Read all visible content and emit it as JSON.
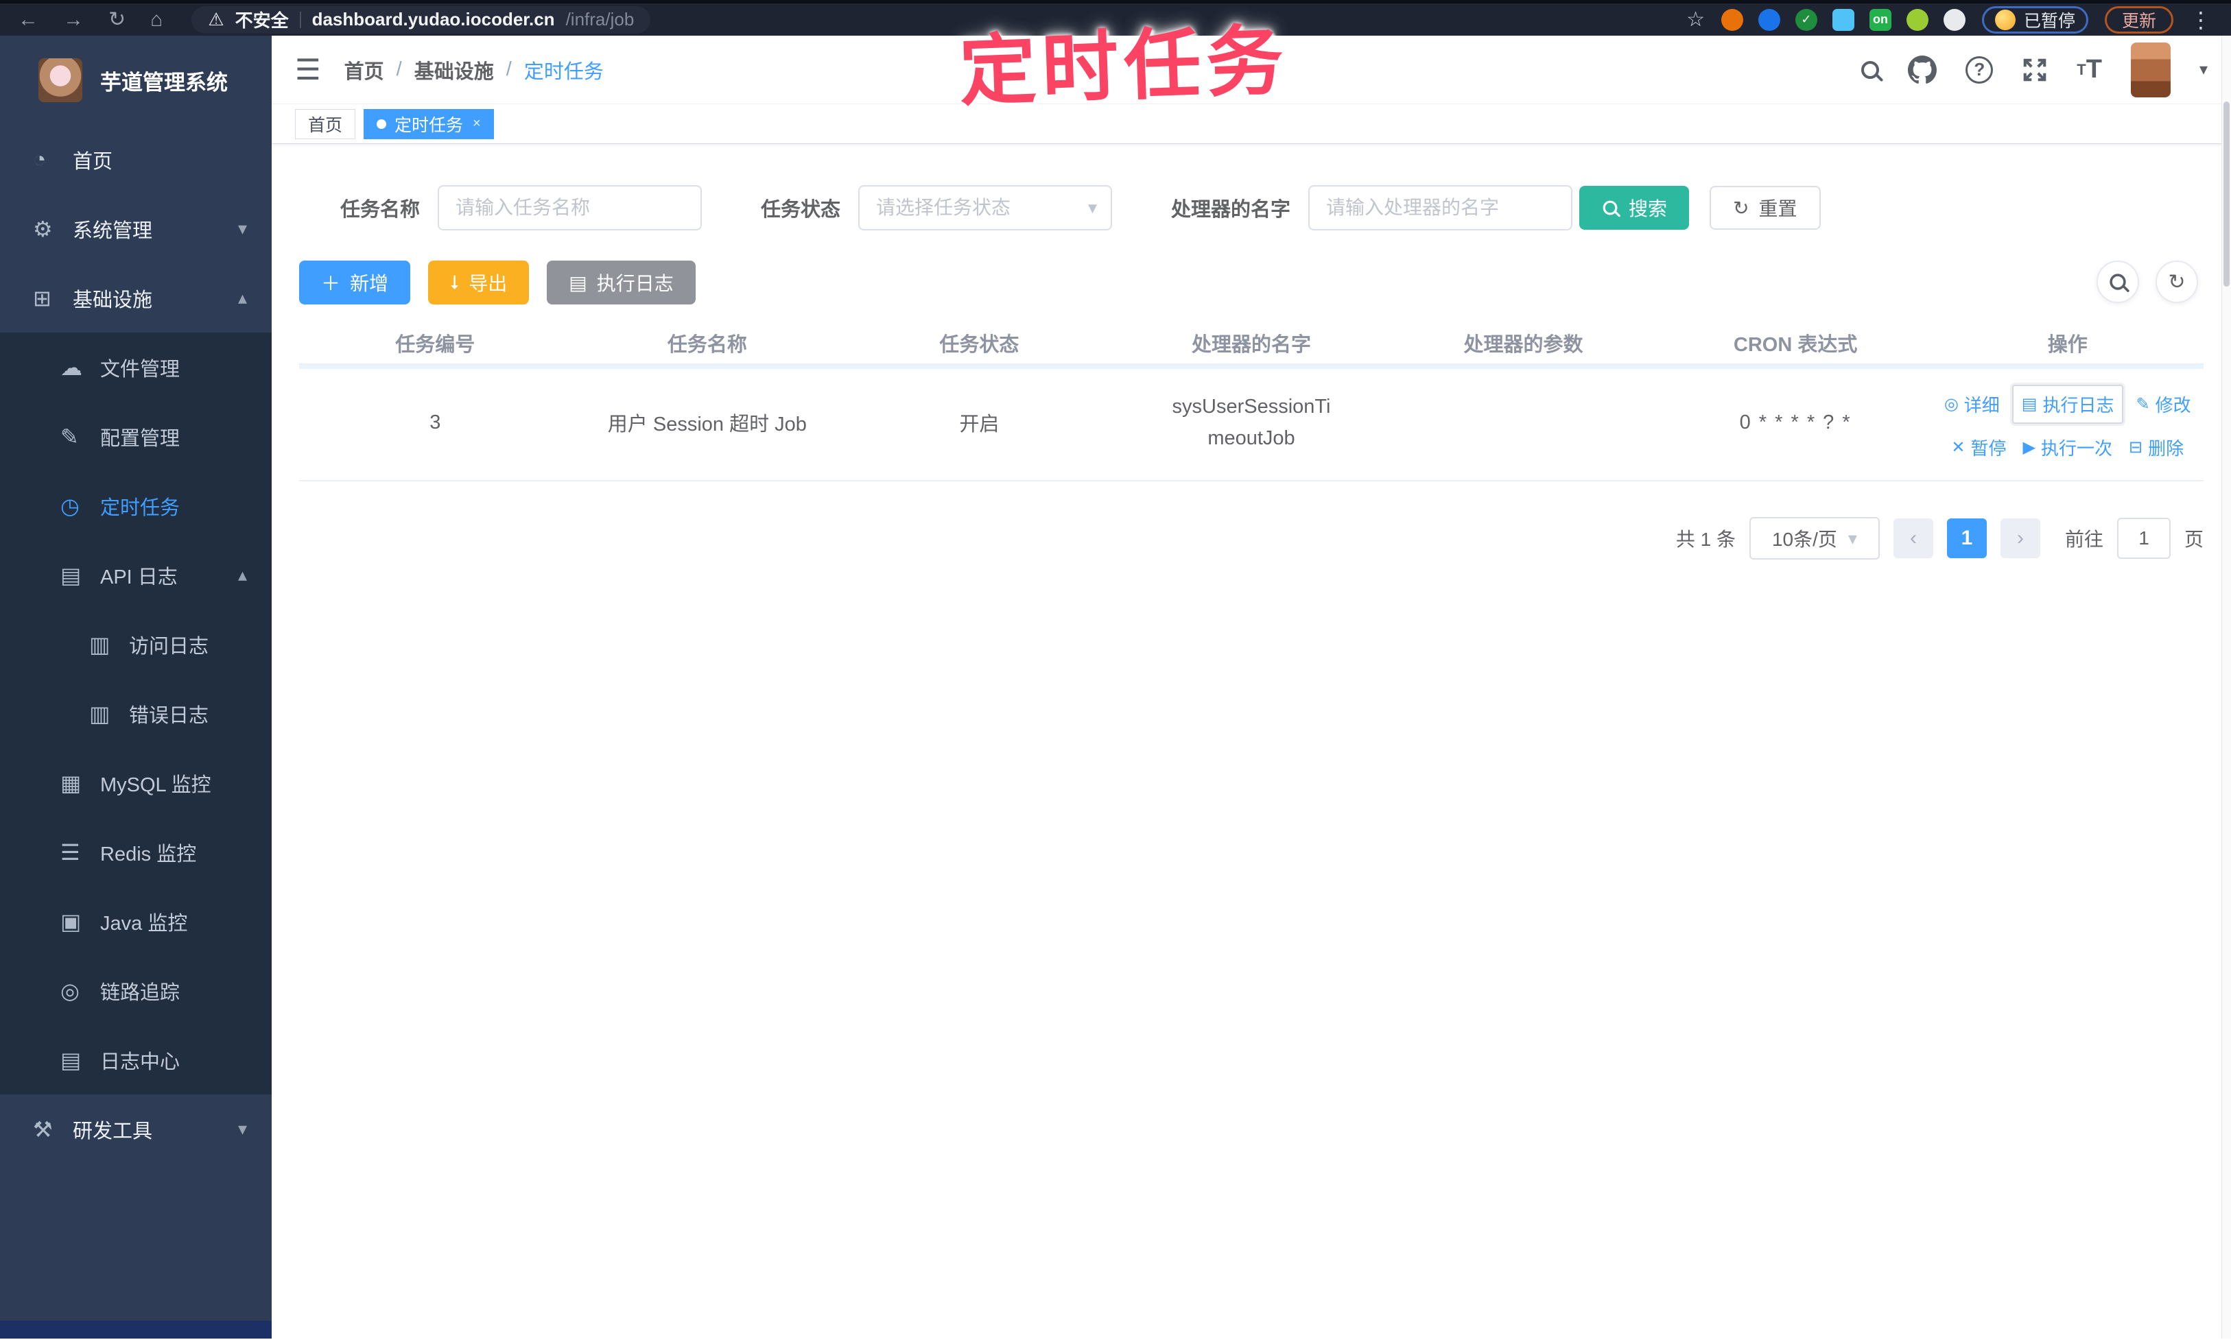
{
  "annotation": "定时任务",
  "browser": {
    "nav_icons": [
      "back-icon",
      "forward-icon",
      "reload-icon",
      "home-icon"
    ],
    "security_warning": "不安全",
    "url_host": "dashboard.yudao.iocoder.cn",
    "url_path": "/infra/job",
    "bookmark_icon": "bookmark-star-icon",
    "extensions": [
      {
        "name": "extension-orange-icon",
        "color": "#e8710a",
        "shape": "round"
      },
      {
        "name": "extension-blue-icon",
        "color": "#1a73e8",
        "shape": "round"
      },
      {
        "name": "extension-green-check-icon",
        "color": "#1e8e3e",
        "shape": "round",
        "glyph": "✓"
      },
      {
        "name": "extension-lightblue-icon",
        "color": "#4fc3f7",
        "shape": "square"
      },
      {
        "name": "extension-on-badge-icon",
        "color": "#23b14d",
        "shape": "square",
        "glyph": "on"
      },
      {
        "name": "extension-lime-icon",
        "color": "#9acc34",
        "shape": "round"
      },
      {
        "name": "extension-white-icon",
        "color": "#e8eaed",
        "shape": "round"
      }
    ],
    "paused_badge": "已暂停",
    "update_button": "更新"
  },
  "sidebar": {
    "app_title": "芋道管理系统",
    "items": [
      {
        "label": "首页",
        "icon": "dashboard-icon",
        "level": 1
      },
      {
        "label": "系统管理",
        "icon": "gear-icon",
        "level": 1,
        "chevron": "down"
      },
      {
        "label": "基础设施",
        "icon": "infra-grid-icon",
        "level": 1,
        "chevron": "up"
      },
      {
        "label": "文件管理",
        "icon": "cloud-icon",
        "level": 2,
        "sub": true
      },
      {
        "label": "配置管理",
        "icon": "edit-icon",
        "level": 2,
        "sub": true
      },
      {
        "label": "定时任务",
        "icon": "timer-icon",
        "level": 2,
        "sub": true,
        "active": true
      },
      {
        "label": "API 日志",
        "icon": "log-icon",
        "level": 2,
        "sub": true,
        "chevron": "up"
      },
      {
        "label": "访问日志",
        "icon": "doc-icon",
        "level": 3,
        "sub": true
      },
      {
        "label": "错误日志",
        "icon": "doc-icon",
        "level": 3,
        "sub": true
      },
      {
        "label": "MySQL 监控",
        "icon": "database-icon",
        "level": 2,
        "sub": true
      },
      {
        "label": "Redis 监控",
        "icon": "layers-icon",
        "level": 2,
        "sub": true
      },
      {
        "label": "Java 监控",
        "icon": "monitor-icon",
        "level": 2,
        "sub": true
      },
      {
        "label": "链路追踪",
        "icon": "eye-icon",
        "level": 2,
        "sub": true
      },
      {
        "label": "日志中心",
        "icon": "log-center-icon",
        "level": 2,
        "sub": true
      },
      {
        "label": "研发工具",
        "icon": "tools-icon",
        "level": 1,
        "chevron": "down"
      }
    ]
  },
  "header": {
    "breadcrumb": [
      "首页",
      "基础设施",
      "定时任务"
    ],
    "right_icons": [
      "search-icon",
      "github-icon",
      "help-icon",
      "fullscreen-icon",
      "font-size-icon"
    ]
  },
  "tags": [
    {
      "label": "首页",
      "active": false,
      "closable": false
    },
    {
      "label": "定时任务",
      "active": true,
      "closable": true
    }
  ],
  "filters": {
    "name_label": "任务名称",
    "name_placeholder": "请输入任务名称",
    "status_label": "任务状态",
    "status_placeholder": "请选择任务状态",
    "handler_label": "处理器的名字",
    "handler_placeholder": "请输入处理器的名字",
    "search_label": "搜索",
    "reset_label": "重置"
  },
  "toolbar": {
    "add_label": "新增",
    "export_label": "导出",
    "exec_log_label": "执行日志",
    "right_icons": [
      "search-circle-icon",
      "refresh-circle-icon"
    ]
  },
  "table": {
    "columns": [
      "任务编号",
      "任务名称",
      "任务状态",
      "处理器的名字",
      "处理器的参数",
      "CRON 表达式",
      "操作"
    ],
    "rows": [
      {
        "id": "3",
        "name": "用户 Session 超时 Job",
        "status": "开启",
        "handler": "sysUserSessionTimeoutJob",
        "params": "",
        "cron": "0 * * * * ? *",
        "actions": [
          [
            {
              "label": "详细",
              "icon": "eye-icon"
            },
            {
              "label": "执行日志",
              "icon": "log-icon",
              "focused": true
            },
            {
              "label": "修改",
              "icon": "edit-icon"
            }
          ],
          [
            {
              "label": "暂停",
              "icon": "close-icon"
            },
            {
              "label": "执行一次",
              "icon": "play-icon"
            },
            {
              "label": "删除",
              "icon": "trash-icon"
            }
          ]
        ]
      }
    ]
  },
  "pagination": {
    "total": "共 1 条",
    "page_size": "10条/页",
    "prev": "‹",
    "next": "›",
    "current": "1",
    "goto_label": "前往",
    "goto_value": "1",
    "unit_label": "页"
  },
  "colors": {
    "accent": "#409EFF",
    "search_button": "#2cb9a0",
    "export_button": "#fbb022",
    "gray_button": "#909399",
    "sidebar_bg": "#2e3d55",
    "submenu_bg": "#202e40",
    "annotation": "#fb4463"
  }
}
